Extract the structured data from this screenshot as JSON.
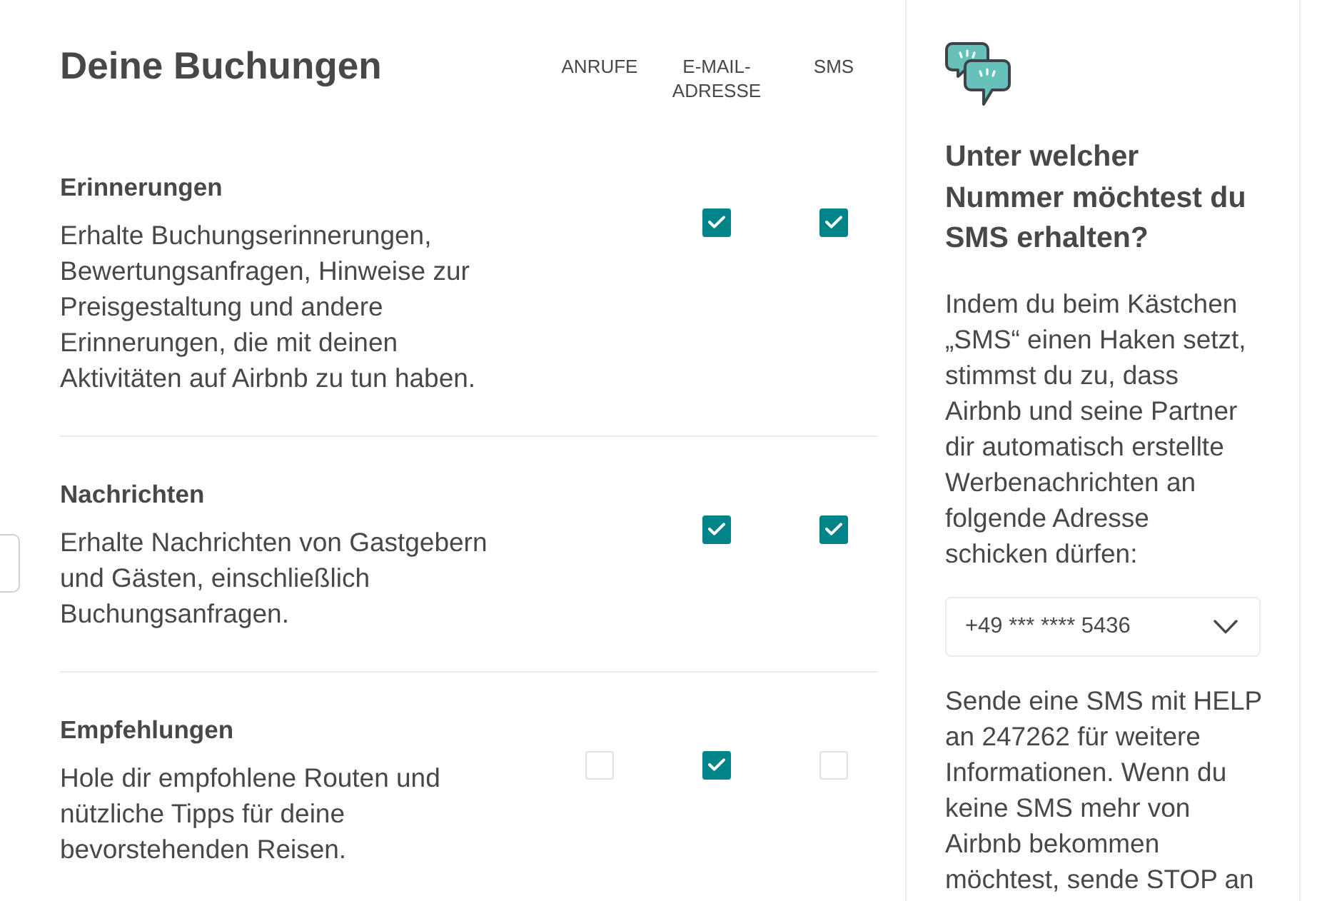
{
  "section": {
    "title": "Deine Buchungen",
    "columns": [
      "ANRUFE",
      "E-MAIL-ADRESSE",
      "SMS"
    ]
  },
  "rows": [
    {
      "title": "Erinnerungen",
      "description": "Erhalte Buchungserinnerungen, Bewertungsanfragen, Hinweise zur Preisgestaltung und andere Erinnerungen, die mit deinen Aktivitäten auf Airbnb zu tun haben.",
      "checks": [
        {
          "kind": "none"
        },
        {
          "kind": "checkbox",
          "checked": true
        },
        {
          "kind": "checkbox",
          "checked": true
        }
      ]
    },
    {
      "title": "Nachrichten",
      "description": "Erhalte Nachrichten von Gastgebern und Gästen, einschließlich Buchungsanfragen.",
      "checks": [
        {
          "kind": "none"
        },
        {
          "kind": "checkbox",
          "checked": true
        },
        {
          "kind": "checkbox",
          "checked": true
        }
      ]
    },
    {
      "title": "Empfehlungen",
      "description": "Hole dir empfohlene Routen und nützliche Tipps für deine bevorstehenden Reisen.",
      "checks": [
        {
          "kind": "checkbox",
          "checked": false
        },
        {
          "kind": "checkbox",
          "checked": true
        },
        {
          "kind": "checkbox",
          "checked": false
        }
      ]
    }
  ],
  "sms_panel": {
    "title": "Unter welcher Nummer möchtest du SMS erhalten?",
    "consent": "Indem du beim Kästchen „SMS“ einen Haken setzt, stimmst du zu, dass Airbnb und seine Partner dir automatisch erstellte Werbenachrichten an folgende Adresse schicken dürfen:",
    "phone_select": {
      "value": "+49 *** **** 5436"
    },
    "help": "Sende eine SMS mit HELP an 247262 für weitere Informationen. Wenn du keine SMS mehr von Airbnb bekommen möchtest, sende STOP an"
  }
}
